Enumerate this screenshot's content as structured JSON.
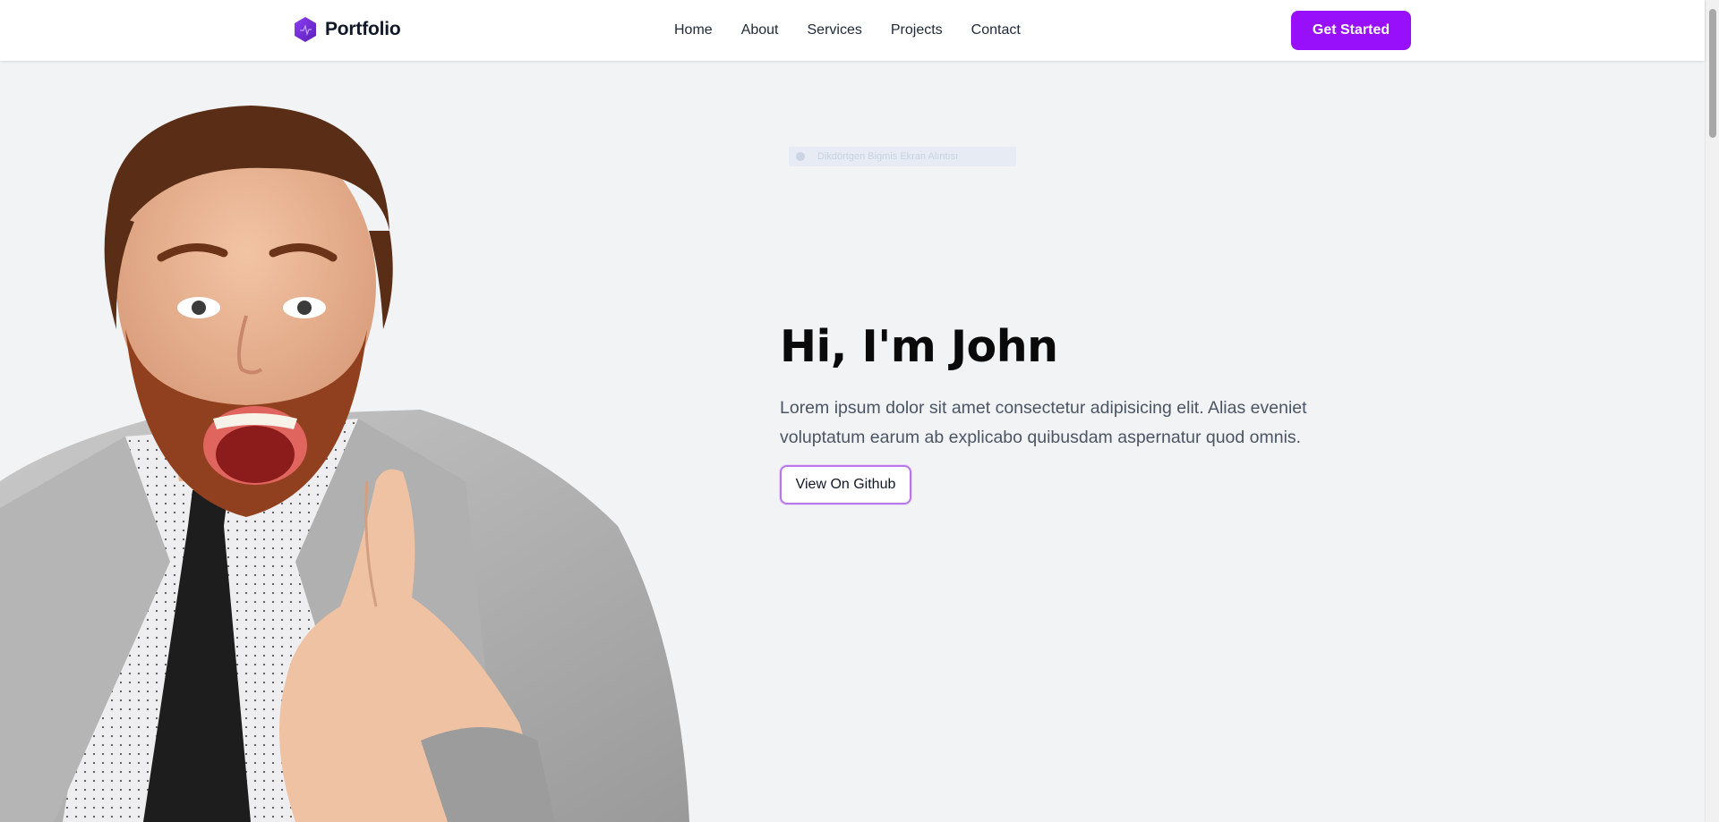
{
  "navbar": {
    "brand": "Portfolio",
    "links": [
      "Home",
      "About",
      "Services",
      "Projects",
      "Contact"
    ],
    "cta": "Get Started"
  },
  "translate_bar": {
    "text": "Dikdörtgen Bigmis Ekran Alıntısı"
  },
  "hero": {
    "title": "Hi, I'm John",
    "description": "Lorem ipsum dolor sit amet consectetur adipisicing elit. Alias eveniet voluptatum earum ab explicabo quibusdam aspernatur quod omnis.",
    "button": "View On Github"
  },
  "colors": {
    "accent": "#9810fa",
    "background": "#f2f3f5",
    "button_border": "#b57ae8"
  }
}
